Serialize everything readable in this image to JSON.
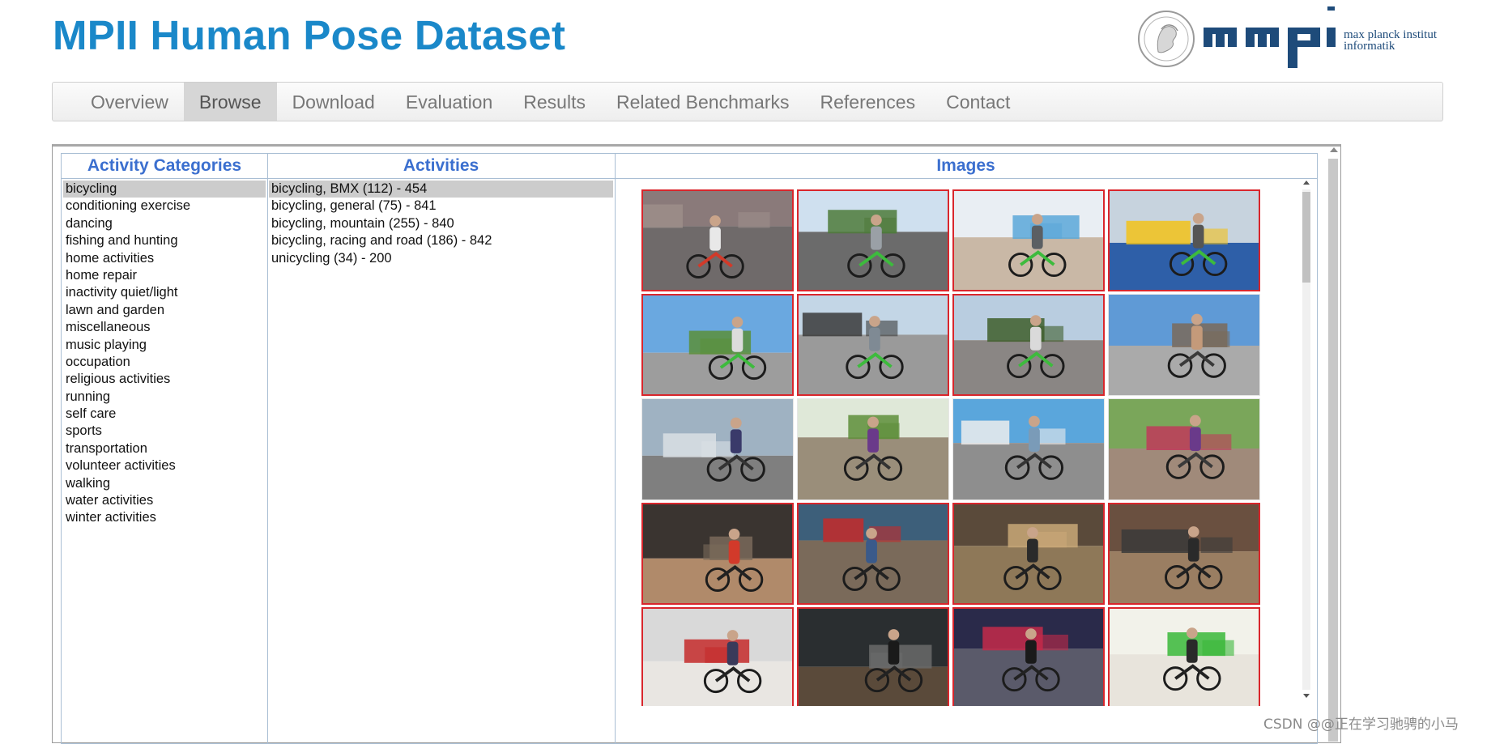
{
  "page": {
    "title": "MPII Human Pose Dataset"
  },
  "logo": {
    "line1": "max planck institut",
    "line2": "informatik"
  },
  "nav": {
    "items": [
      {
        "label": "Overview",
        "active": false
      },
      {
        "label": "Browse",
        "active": true
      },
      {
        "label": "Download",
        "active": false
      },
      {
        "label": "Evaluation",
        "active": false
      },
      {
        "label": "Results",
        "active": false
      },
      {
        "label": "Related Benchmarks",
        "active": false
      },
      {
        "label": "References",
        "active": false
      },
      {
        "label": "Contact",
        "active": false
      }
    ]
  },
  "categories": {
    "header": "Activity Categories",
    "selected_index": 0,
    "items": [
      "bicycling",
      "conditioning exercise",
      "dancing",
      "fishing and hunting",
      "home activities",
      "home repair",
      "inactivity quiet/light",
      "lawn and garden",
      "miscellaneous",
      "music playing",
      "occupation",
      "religious activities",
      "running",
      "self care",
      "sports",
      "transportation",
      "volunteer activities",
      "walking",
      "water activities",
      "winter activities"
    ]
  },
  "activities": {
    "header": "Activities",
    "selected_index": 0,
    "items": [
      "bicycling, BMX (112) - 454",
      "bicycling, general (75) - 841",
      "bicycling, mountain (255) - 840",
      "bicycling, racing and road (186) - 842",
      "unicycling (34) - 200"
    ]
  },
  "images": {
    "header": "Images",
    "thumbnails": [
      {
        "scene": "stone-wall",
        "marked": true
      },
      {
        "scene": "trees-road",
        "marked": true
      },
      {
        "scene": "building-pool",
        "marked": true
      },
      {
        "scene": "indoor-garage",
        "marked": true
      },
      {
        "scene": "sky-ledge",
        "marked": true
      },
      {
        "scene": "plaza-ramp",
        "marked": true
      },
      {
        "scene": "trees-plaza",
        "marked": true
      },
      {
        "scene": "concrete-block",
        "marked": false
      },
      {
        "scene": "grey-plaza",
        "marked": false
      },
      {
        "scene": "green-hill",
        "marked": false
      },
      {
        "scene": "blue-building",
        "marked": false
      },
      {
        "scene": "rocks-trees",
        "marked": false
      },
      {
        "scene": "indoor-dark",
        "marked": true
      },
      {
        "scene": "indoor-ramp",
        "marked": true
      },
      {
        "scene": "wood-ramp",
        "marked": true
      },
      {
        "scene": "graffiti-ramp",
        "marked": true
      },
      {
        "scene": "foam-pit",
        "marked": true
      },
      {
        "scene": "dark-hall",
        "marked": true
      },
      {
        "scene": "arena",
        "marked": true
      },
      {
        "scene": "green-wall",
        "marked": true
      }
    ]
  },
  "watermark": "CSDN @@正在学习驰骋的小马",
  "colors": {
    "title": "#1a88c9",
    "panel_header": "#3b6fcf",
    "thumb_marked_border": "#d9262c",
    "nav_active": "#d6d6d6"
  }
}
